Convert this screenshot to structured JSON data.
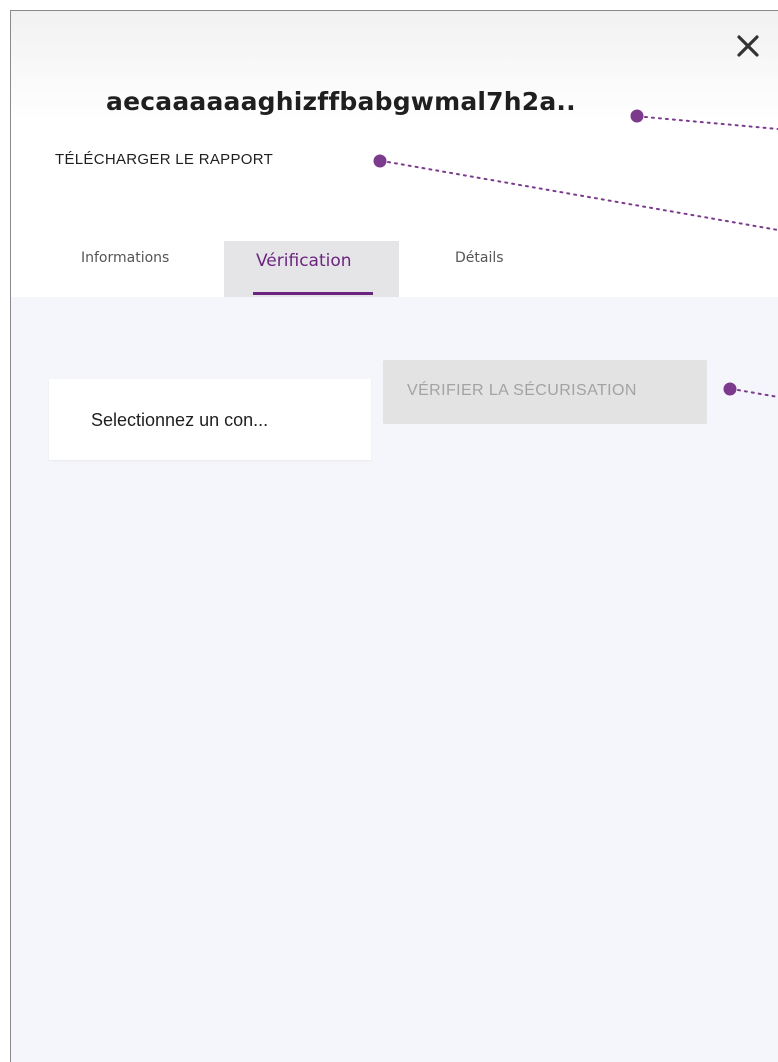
{
  "header": {
    "document_title": "aecaaaaaaghizffbabgwmal7h2a..",
    "download_report_label": "TÉLÉCHARGER LE RAPPORT",
    "close_icon": "close-icon"
  },
  "tabs": [
    {
      "label": "Informations",
      "active": false
    },
    {
      "label": "Vérification",
      "active": true
    },
    {
      "label": "Détails",
      "active": false
    }
  ],
  "verification": {
    "selector_value": "Selectionnez un con...",
    "verify_button_label": "VÉRIFIER LA SÉCURISATION",
    "verify_button_disabled": true
  },
  "colors": {
    "accent": "#6a2580",
    "annotation": "#7b3a8c",
    "content_background": "#f5f6fb",
    "disabled_button": "#e3e3e3"
  }
}
